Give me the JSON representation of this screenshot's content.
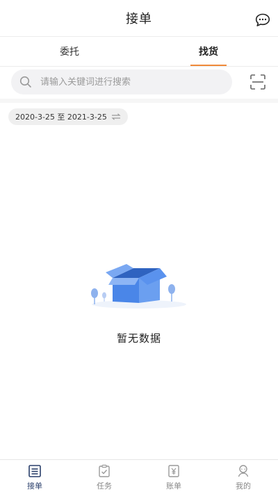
{
  "header": {
    "title": "接单",
    "message_icon": "chat-bubble-icon"
  },
  "tabs": [
    {
      "label": "委托",
      "active": false
    },
    {
      "label": "找货",
      "active": true
    }
  ],
  "search": {
    "placeholder": "请输入关键词进行搜索",
    "value": "",
    "scan_icon": "scan-icon"
  },
  "filter": {
    "date_range": "2020-3-25 至 2021-3-25",
    "swap_icon": "swap-arrows-icon"
  },
  "empty_state": {
    "text": "暂无数据",
    "illustration": "open-box-icon"
  },
  "bottom_nav": [
    {
      "label": "接单",
      "icon": "list-icon",
      "active": true
    },
    {
      "label": "任务",
      "icon": "clipboard-check-icon",
      "active": false
    },
    {
      "label": "账单",
      "icon": "yuan-bill-icon",
      "active": false
    },
    {
      "label": "我的",
      "icon": "user-icon",
      "active": false
    }
  ],
  "colors": {
    "accent_orange": "#f08a3a",
    "nav_active": "#2a3f6b",
    "box_blue": "#4a86e8"
  }
}
